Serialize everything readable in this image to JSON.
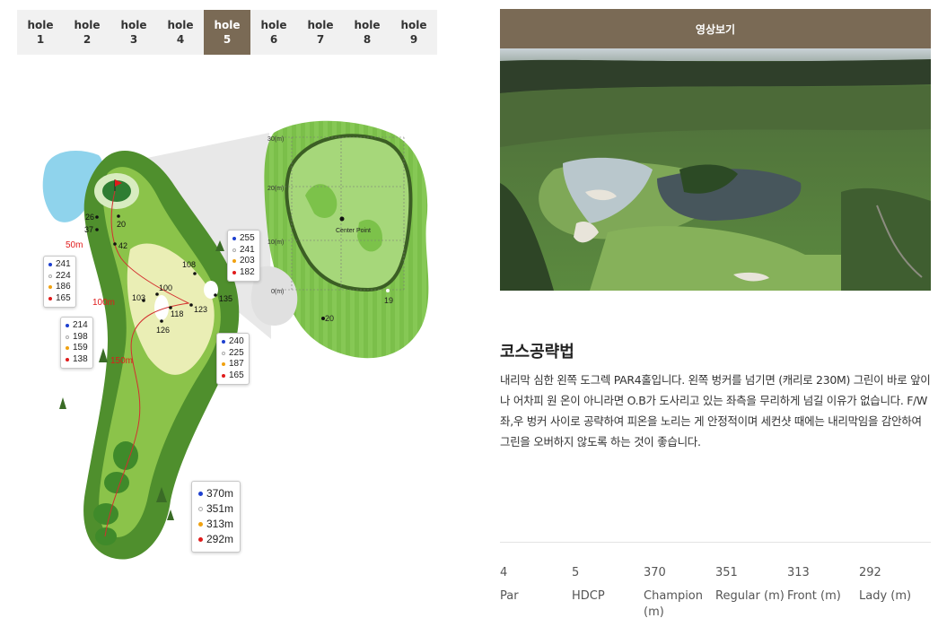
{
  "holes": [
    {
      "label": "hole",
      "num": "1"
    },
    {
      "label": "hole",
      "num": "2"
    },
    {
      "label": "hole",
      "num": "3"
    },
    {
      "label": "hole",
      "num": "4"
    },
    {
      "label": "hole",
      "num": "5"
    },
    {
      "label": "hole",
      "num": "6"
    },
    {
      "label": "hole",
      "num": "7"
    },
    {
      "label": "hole",
      "num": "8"
    },
    {
      "label": "hole",
      "num": "9"
    }
  ],
  "active_hole": 5,
  "map": {
    "green_grid_labels": [
      "30(m)",
      "20(m)",
      "10(m)",
      "0(m)"
    ],
    "center_point": "Center Point",
    "green_dist_19": "19",
    "green_dist_20": "20",
    "marker_50": "50m",
    "marker_100": "100m",
    "marker_150": "150m",
    "points": {
      "p26": "26",
      "p20": "20",
      "p37": "37",
      "p42": "42",
      "p108": "108",
      "p100": "100",
      "p103": "103",
      "p118": "118",
      "p123": "123",
      "p135": "135",
      "p126": "126"
    },
    "box_a": [
      "255",
      "241",
      "203",
      "182"
    ],
    "box_b": [
      "241",
      "224",
      "186",
      "165"
    ],
    "box_c": [
      "214",
      "198",
      "159",
      "138"
    ],
    "box_d": [
      "240",
      "225",
      "187",
      "165"
    ],
    "total": [
      "370m",
      "351m",
      "313m",
      "292m"
    ]
  },
  "tee_colors": [
    "#1d3fcf",
    "#ffffff",
    "#f0a10f",
    "#e01b1b"
  ],
  "video_button": "영상보기",
  "course": {
    "title": "코스공략법",
    "description": "내리막 심한 왼쪽 도그렉 PAR4홀입니다. 왼쪽 벙커를 넘기면 (캐리로 230M) 그린이 바로 앞이나 어차피 원 온이 아니라면 O.B가 도사리고 있는 좌측을 무리하게 넘길 이유가 없습니다. F/W 좌,우 벙커 사이로 공략하여 피온을 노리는 게 안정적이며 세컨샷 때에는 내리막임을 감안하여 그린을 오버하지 않도록 하는 것이 좋습니다."
  },
  "stats": [
    {
      "value": "4",
      "label": "Par"
    },
    {
      "value": "5",
      "label": "HDCP"
    },
    {
      "value": "370",
      "label": "Champion (m)"
    },
    {
      "value": "351",
      "label": "Regular (m)"
    },
    {
      "value": "313",
      "label": "Front (m)"
    },
    {
      "value": "292",
      "label": "Lady (m)"
    }
  ]
}
